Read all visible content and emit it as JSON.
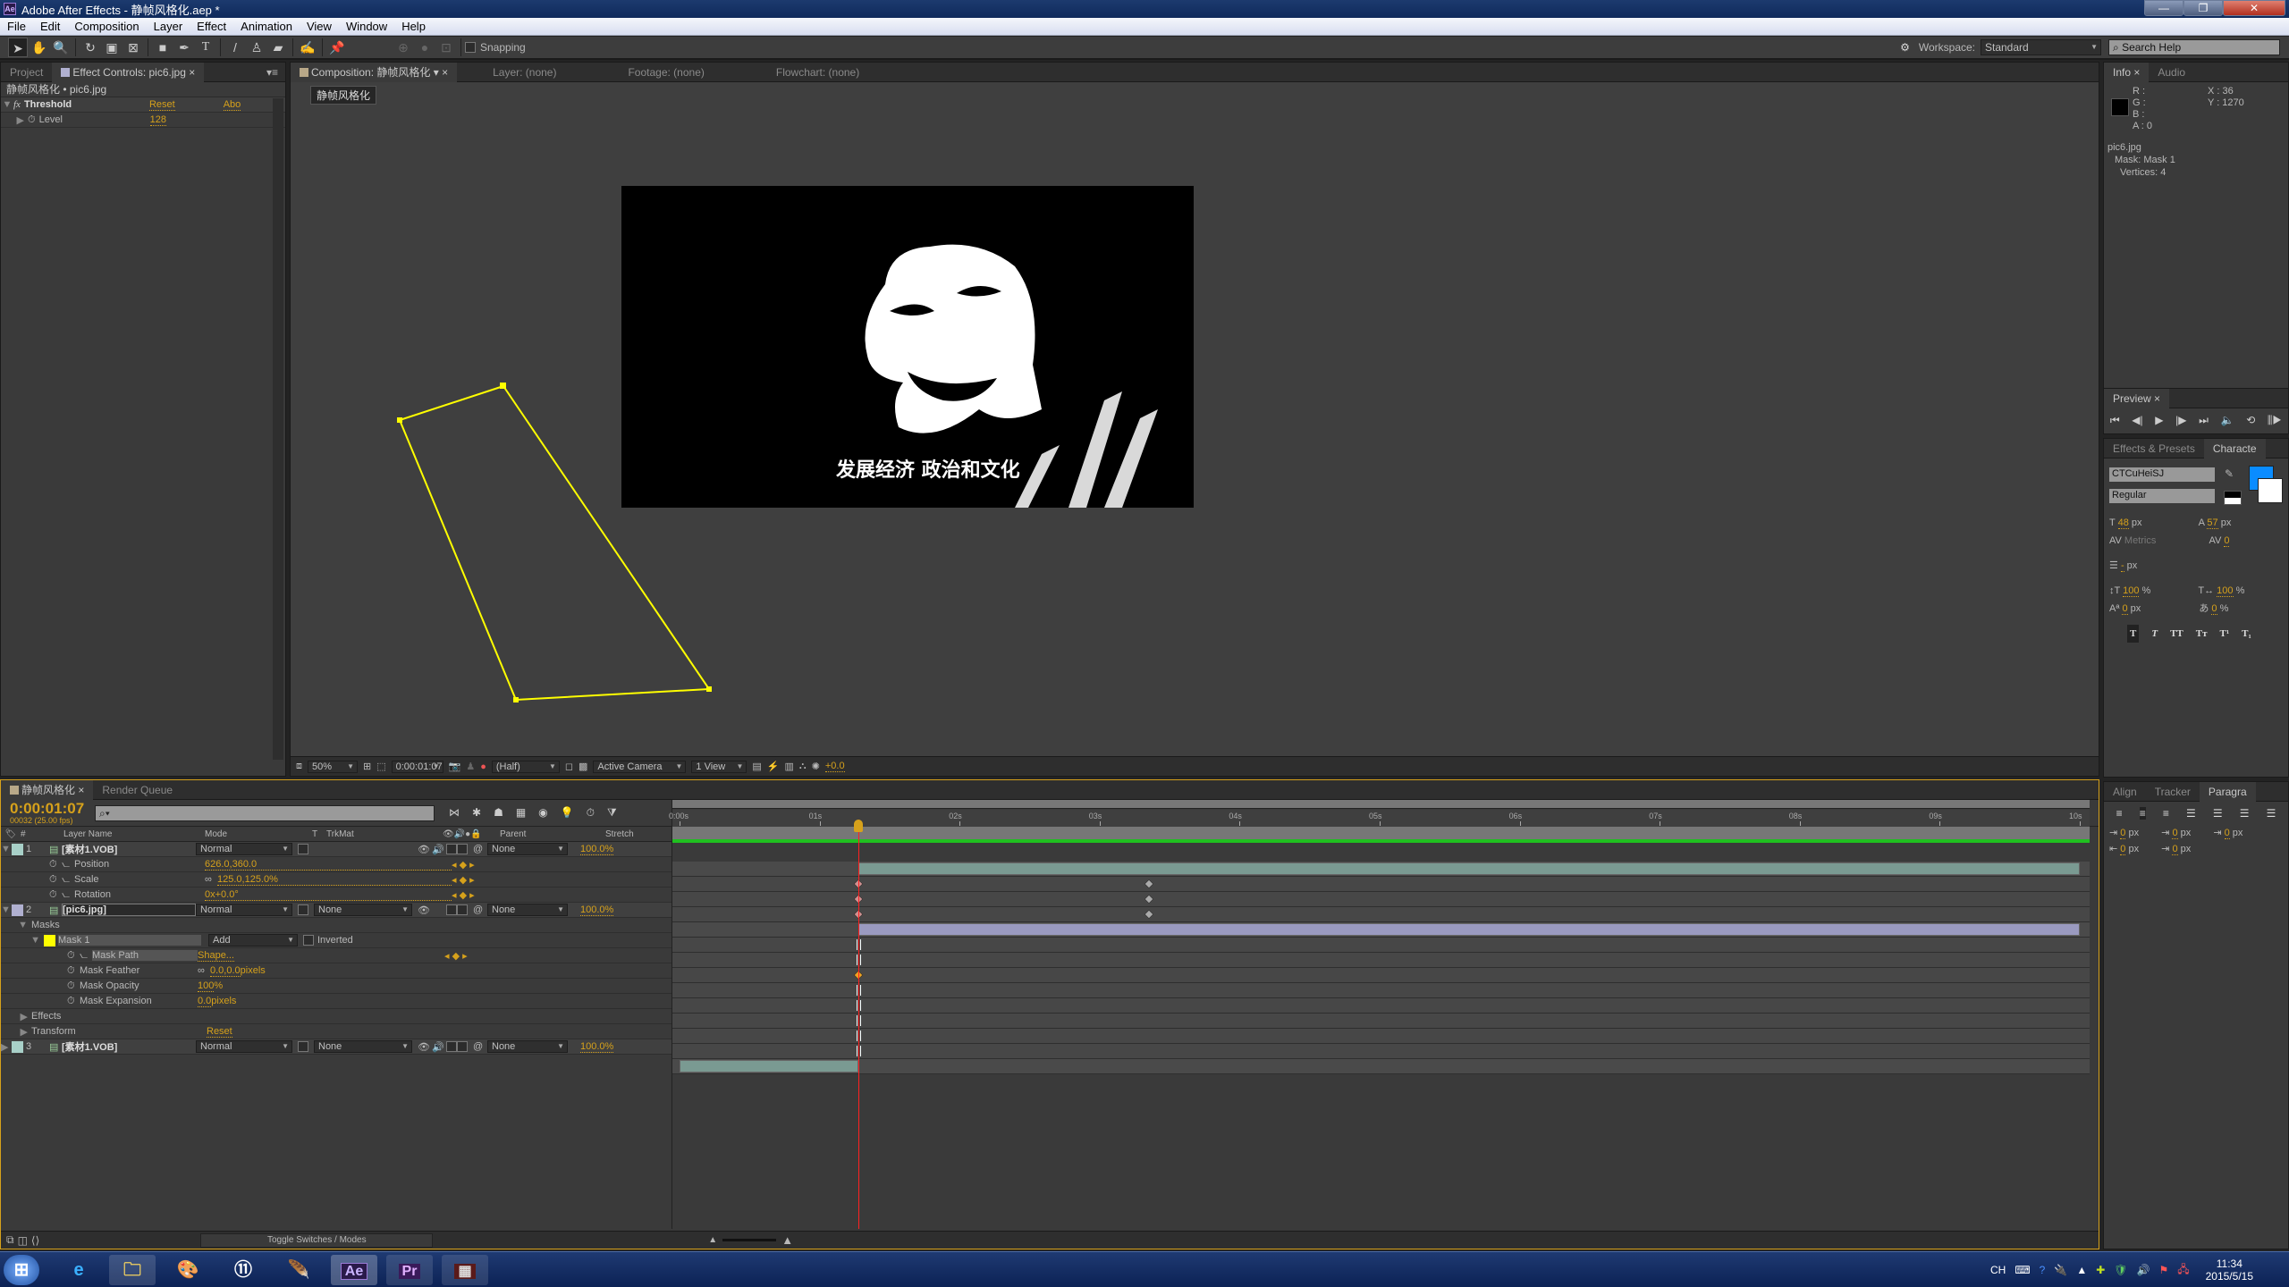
{
  "window": {
    "title": "Adobe After Effects - 静帧风格化.aep *",
    "app_icon": "Ae",
    "controls": [
      "minimize",
      "restore",
      "close"
    ]
  },
  "menu": [
    "File",
    "Edit",
    "Composition",
    "Layer",
    "Effect",
    "Animation",
    "View",
    "Window",
    "Help"
  ],
  "toolbar": {
    "tools": [
      "selection-tool",
      "hand-tool",
      "zoom-tool",
      "rotate-tool",
      "camera-tool",
      "pan-behind-tool",
      "rectangle-tool",
      "pen-tool",
      "type-tool",
      "brush-tool",
      "clone-stamp-tool",
      "eraser-tool",
      "roto-brush-tool",
      "puppet-pin-tool"
    ],
    "snapping_label": "Snapping",
    "snapping_checked": false,
    "workspace_label": "Workspace:",
    "workspace_value": "Standard",
    "search_placeholder": "Search Help"
  },
  "left_panel": {
    "tabs": [
      "Project",
      "Effect Controls: pic6.jpg"
    ],
    "header": "静帧风格化 • pic6.jpg",
    "effect": {
      "name": "Threshold",
      "reset": "Reset",
      "about": "Abo",
      "param_label": "Level",
      "param_value": "128"
    }
  },
  "comp_panel": {
    "tabs": [
      "Composition: 静帧风格化",
      "Layer: (none)",
      "Footage: (none)",
      "Flowchart: (none)"
    ],
    "breadcrumb": "静帧风格化",
    "subtitle_text": "发展经济 政治和文化",
    "footer": {
      "zoom": "50%",
      "timecode": "0:00:01:07",
      "resolution": "(Half)",
      "camera": "Active Camera",
      "views": "1 View",
      "exposure": "+0.0"
    }
  },
  "info_panel": {
    "tabs": [
      "Info",
      "Audio"
    ],
    "r": "R :",
    "g": "G :",
    "b": "B :",
    "a": "A : 0",
    "x": "X : 36",
    "y": "Y : 1270",
    "layer": "pic6.jpg",
    "mask": "Mask: Mask 1",
    "vertices": "Vertices: 4"
  },
  "preview_panel": {
    "tab": "Preview",
    "controls": [
      "first-frame",
      "prev-frame",
      "play",
      "next-frame",
      "last-frame",
      "audio",
      "loop",
      "ram-preview"
    ]
  },
  "character_panel": {
    "tabs": [
      "Effects & Presets",
      "Characte"
    ],
    "font": "CTCuHeiSJ",
    "style": "Regular",
    "fill_color": "#0a8cff",
    "size": "48",
    "size_unit": "px",
    "leading": "57",
    "leading_unit": "px",
    "kerning": "Metrics",
    "tracking": "0",
    "stroke": "-",
    "stroke_unit": "px",
    "vscale": "100",
    "vscale_unit": "%",
    "hscale": "100",
    "hscale_unit": "%",
    "baseline": "0",
    "baseline_unit": "px",
    "tsume": "0",
    "tsume_unit": "%",
    "styles": [
      "T",
      "T",
      "TT",
      "Tт",
      "T¹",
      "T₁"
    ]
  },
  "paragraph_panel": {
    "tabs": [
      "Align",
      "Tracker",
      "Paragra"
    ],
    "indents": [
      {
        "v": "0",
        "u": "px"
      },
      {
        "v": "0",
        "u": "px"
      },
      {
        "v": "0",
        "u": "px"
      },
      {
        "v": "0",
        "u": "px"
      },
      {
        "v": "0",
        "u": "px"
      }
    ]
  },
  "timeline": {
    "tabs": [
      "静帧风格化",
      "Render Queue"
    ],
    "timecode": "0:00:01:07",
    "frames": "00032 (25.00 fps)",
    "search_placeholder": "",
    "columns": {
      "num": "#",
      "layer_name": "Layer Name",
      "mode": "Mode",
      "t": "T",
      "trkmat": "TrkMat",
      "parent": "Parent",
      "stretch": "Stretch"
    },
    "ruler": [
      "0:00s",
      "01s",
      "02s",
      "03s",
      "04s",
      "05s",
      "06s",
      "07s",
      "08s",
      "09s",
      "10s"
    ],
    "duration_s": 10,
    "current_time_s": 1.28,
    "rows": [
      {
        "type": "layer",
        "num": "1",
        "name": "[素材1.VOB]",
        "mode": "Normal",
        "trkmat": "",
        "parent": "None",
        "stretch": "100.0%",
        "color": "#a8d0c8",
        "bar_start_s": 1.28,
        "bar_end_s": 10,
        "bar_color": "#7a9a92"
      },
      {
        "type": "prop",
        "name": "Position",
        "value": "626.0,360.0",
        "keys_s": [
          1.28,
          3.35
        ]
      },
      {
        "type": "prop",
        "name": "Scale",
        "value": "125.0,125.0%",
        "link": true,
        "keys_s": [
          1.28,
          3.35
        ]
      },
      {
        "type": "prop",
        "name": "Rotation",
        "value": "0x+0.0°",
        "keys_s": [
          1.28,
          3.35
        ]
      },
      {
        "type": "layer",
        "num": "2",
        "name": "[pic6.jpg]",
        "mode": "Normal",
        "trkmat": "None",
        "parent": "None",
        "stretch": "100.0%",
        "color": "#b0b0d0",
        "bar_start_s": 1.28,
        "bar_end_s": 10,
        "bar_color": "#9a9ac0"
      },
      {
        "type": "group",
        "name": "Masks"
      },
      {
        "type": "mask",
        "name": "Mask 1",
        "mode": "Add",
        "inverted_label": "Inverted"
      },
      {
        "type": "maskprop",
        "name": "Mask Path",
        "value": "Shape...",
        "key": true
      },
      {
        "type": "maskprop",
        "name": "Mask Feather",
        "value": "0.0,0.0",
        "unit": "pixels",
        "link": true
      },
      {
        "type": "maskprop",
        "name": "Mask Opacity",
        "value": "100",
        "unit": "%"
      },
      {
        "type": "maskprop",
        "name": "Mask Expansion",
        "value": "0.0",
        "unit": "pixels"
      },
      {
        "type": "group",
        "name": "Effects"
      },
      {
        "type": "group",
        "name": "Transform",
        "value": "Reset"
      },
      {
        "type": "layer",
        "num": "3",
        "name": "[素材1.VOB]",
        "mode": "Normal",
        "trkmat": "None",
        "parent": "None",
        "stretch": "100.0%",
        "color": "#a8d0c8",
        "bar_start_s": 0,
        "bar_end_s": 1.28,
        "bar_color": "#7a9a92"
      }
    ],
    "toggle_label": "Toggle Switches / Modes"
  },
  "taskbar": {
    "apps": [
      "start",
      "internet-explorer",
      "file-explorer",
      "paint",
      "app-11",
      "feather-app",
      "after-effects",
      "premiere",
      "media-encoder"
    ],
    "ime": "CH",
    "time": "11:34",
    "date": "2015/5/15"
  },
  "colors": {
    "accent": "#d6a11b",
    "mask": "#ffff00",
    "playhead": "#ff2020",
    "cache": "#20c020"
  }
}
